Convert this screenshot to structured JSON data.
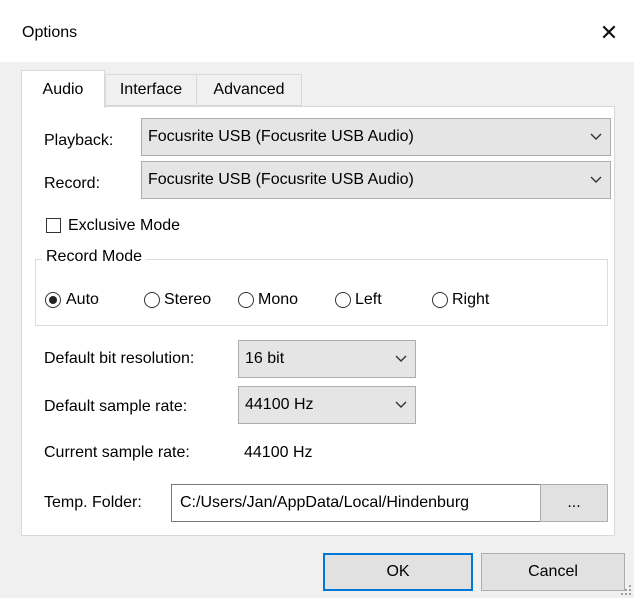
{
  "window": {
    "title": "Options",
    "close_glyph": "✕"
  },
  "tabs": [
    {
      "label": "Audio",
      "active": true
    },
    {
      "label": "Interface",
      "active": false
    },
    {
      "label": "Advanced",
      "active": false
    }
  ],
  "audio": {
    "playback": {
      "label": "Playback:",
      "value": "Focusrite USB (Focusrite USB Audio)"
    },
    "record": {
      "label": "Record:",
      "value": "Focusrite USB (Focusrite USB Audio)"
    },
    "exclusive_mode": {
      "label": "Exclusive Mode",
      "checked": false
    },
    "record_mode": {
      "title": "Record Mode",
      "options": [
        {
          "label": "Auto",
          "checked": true
        },
        {
          "label": "Stereo",
          "checked": false
        },
        {
          "label": "Mono",
          "checked": false
        },
        {
          "label": "Left",
          "checked": false
        },
        {
          "label": "Right",
          "checked": false
        }
      ]
    },
    "bit_resolution": {
      "label": "Default bit resolution:",
      "value": "16 bit"
    },
    "sample_rate": {
      "label": "Default sample rate:",
      "value": "44100 Hz"
    },
    "current_sample_rate": {
      "label": "Current sample rate:",
      "value": "44100 Hz"
    },
    "temp_folder": {
      "label": "Temp. Folder:",
      "value": "C:/Users/Jan/AppData/Local/Hindenburg",
      "browse_label": "..."
    }
  },
  "buttons": {
    "ok": "OK",
    "cancel": "Cancel"
  },
  "colors": {
    "accent": "#0078d7",
    "panel": "#ffffff",
    "background": "#f0f0f0"
  }
}
